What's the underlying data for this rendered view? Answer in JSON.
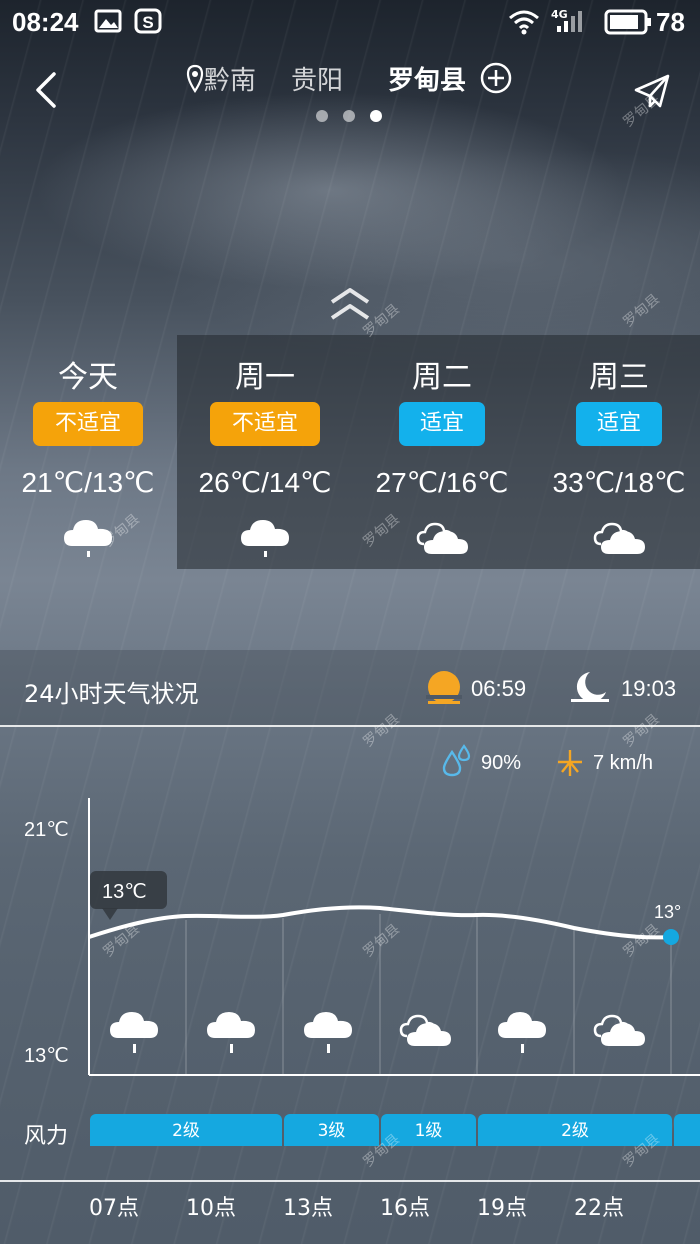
{
  "status_bar": {
    "time": "08:24",
    "icons": [
      "image-icon",
      "sogou-icon",
      "wifi-icon",
      "4g-signal-icon",
      "battery-icon"
    ],
    "network": "4G",
    "battery": "78"
  },
  "header": {
    "cities": [
      "黔南",
      "贵阳",
      "罗甸县"
    ],
    "active_city_index": 2,
    "page_count": 3
  },
  "forecast": [
    {
      "day": "今天",
      "suitability": "不适宜",
      "suitability_color": "#f5a30a",
      "temp": "21℃/13℃",
      "icon": "rain-cloud-icon"
    },
    {
      "day": "周一",
      "suitability": "不适宜",
      "suitability_color": "#f5a30a",
      "temp": "26℃/14℃",
      "icon": "rain-cloud-icon"
    },
    {
      "day": "周二",
      "suitability": "适宜",
      "suitability_color": "#13b1ec",
      "temp": "27℃/16℃",
      "icon": "cloudy-icon"
    },
    {
      "day": "周三",
      "suitability": "适宜",
      "suitability_color": "#13b1ec",
      "temp": "33℃/18℃",
      "icon": "cloudy-icon"
    }
  ],
  "hourly": {
    "title": "24小时天气状况",
    "sunrise": "06:59",
    "sunset": "19:03",
    "humidity": "90%",
    "wind_speed": "7 km/h",
    "y_max_label": "21℃",
    "y_min_label": "13℃",
    "tooltip": "13℃",
    "end_label": "13°",
    "wind_label": "风力",
    "wind_levels": [
      "2级",
      "3级",
      "1级",
      "2级"
    ],
    "hours": [
      "07点",
      "10点",
      "13点",
      "16点",
      "19点",
      "22点"
    ]
  },
  "colors": {
    "orange": "#f5a30a",
    "blue": "#13b1ec",
    "sun": "#f5a623"
  },
  "watermark": "罗甸县"
}
